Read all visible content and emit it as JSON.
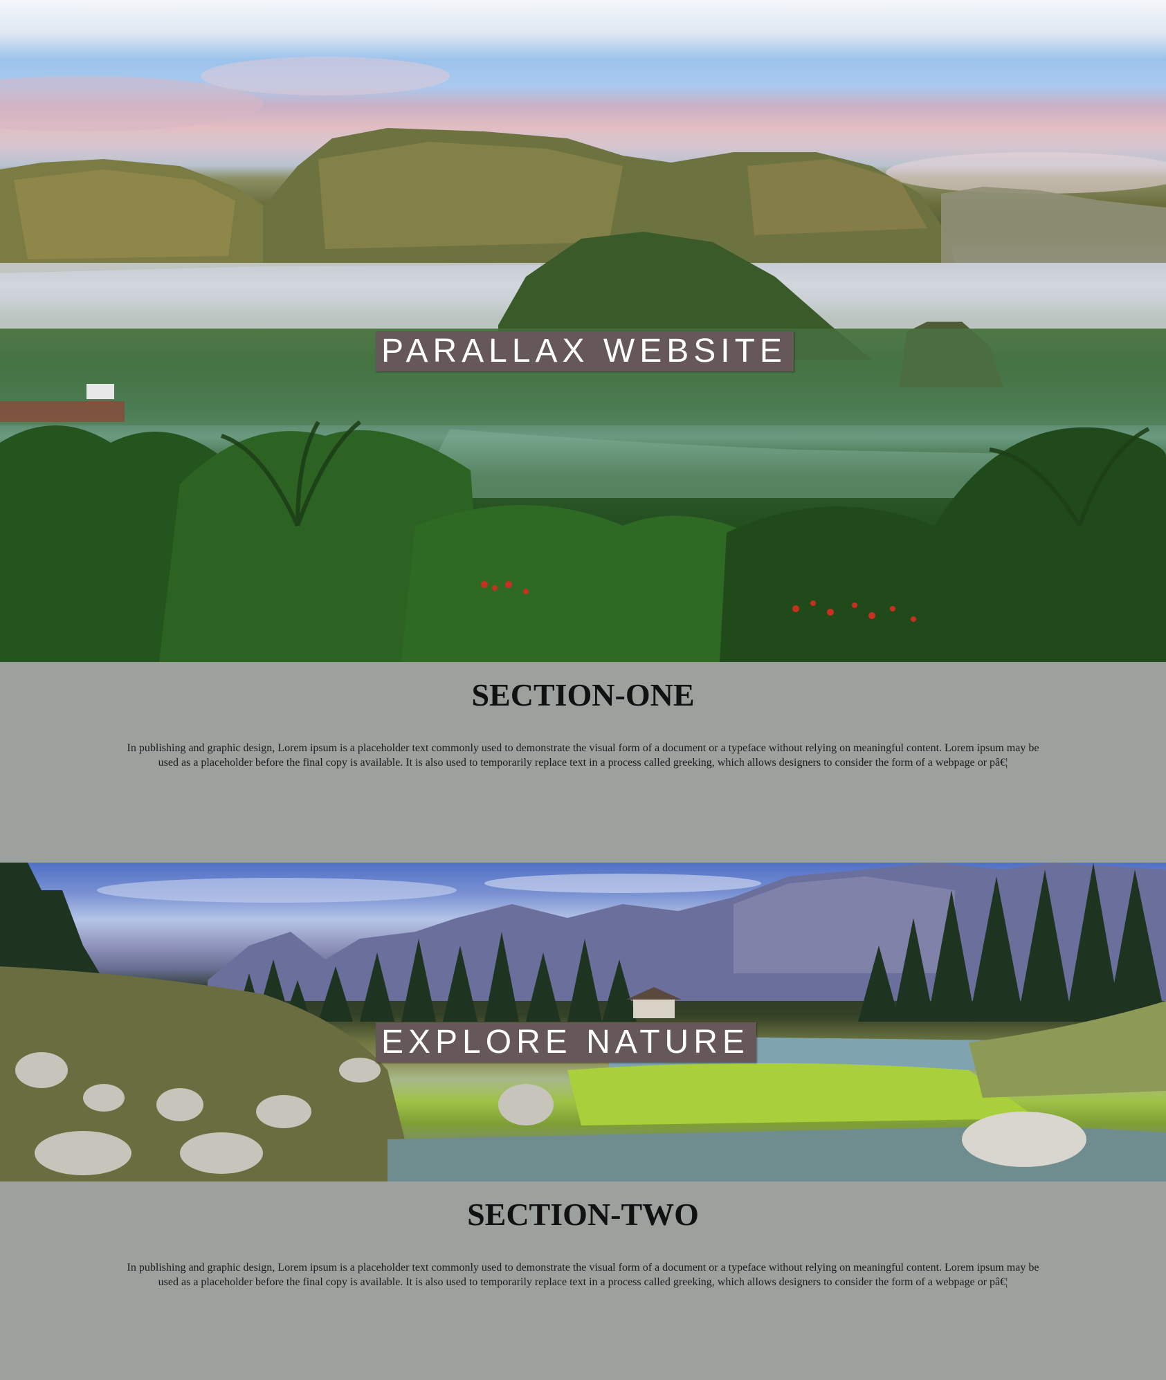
{
  "hero_one": {
    "label": "PARALLAX WEBSITE"
  },
  "section_one": {
    "heading": "SECTION-ONE",
    "body": "In publishing and graphic design, Lorem ipsum is a placeholder text commonly used to demonstrate the visual form of a document or a typeface without relying on meaningful content. Lorem ipsum may be used as a placeholder before the final copy is available. It is also used to temporarily replace text in a process called greeking, which allows designers to consider the form of a webpage or pâ€¦"
  },
  "hero_two": {
    "label": "EXPLORE NATURE"
  },
  "section_two": {
    "heading": "SECTION-TWO",
    "body": "In publishing and graphic design, Lorem ipsum is a placeholder text commonly used to demonstrate the visual form of a document or a typeface without relying on meaningful content. Lorem ipsum may be used as a placeholder before the final copy is available. It is also used to temporarily replace text in a process called greeking, which allows designers to consider the form of a webpage or pâ€¦"
  },
  "colors": {
    "page_background": "#9ca19d",
    "label_background": "#665858",
    "label_text": "#ffffff",
    "heading_text": "#111111"
  }
}
